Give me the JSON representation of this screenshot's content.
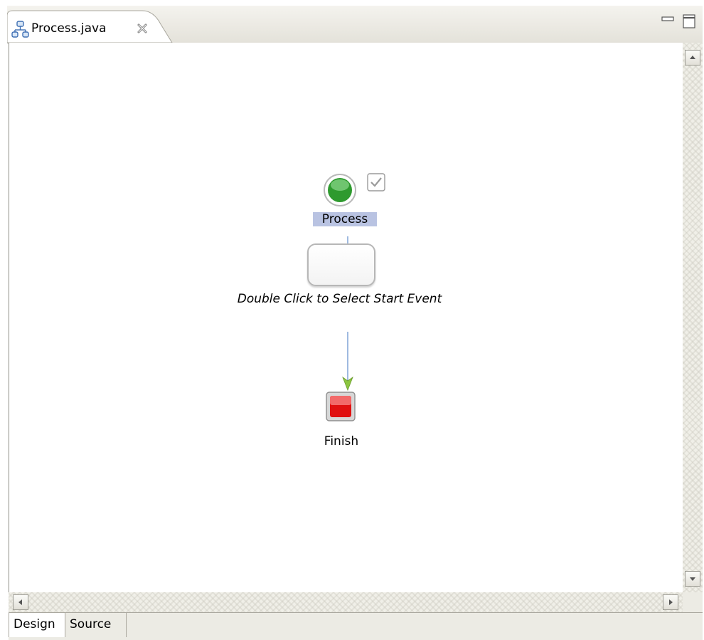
{
  "editor": {
    "tab_title": "Process.java",
    "tab_icon": "process-diagram-icon",
    "close_icon": "close-icon",
    "minimize_icon": "minimize-icon",
    "maximize_icon": "maximize-icon"
  },
  "diagram": {
    "start_node": {
      "label": "Process",
      "icon": "start-event-circle-icon",
      "color": "#2e9a2e"
    },
    "validation_icon": "checkmark-icon",
    "task_node": {
      "label": "Double Click to Select Start Event"
    },
    "end_node": {
      "label": "Finish",
      "icon": "end-event-square-icon",
      "color": "#e01010"
    }
  },
  "bottom_tabs": [
    {
      "label": "Design",
      "active": true
    },
    {
      "label": "Source",
      "active": false
    }
  ]
}
